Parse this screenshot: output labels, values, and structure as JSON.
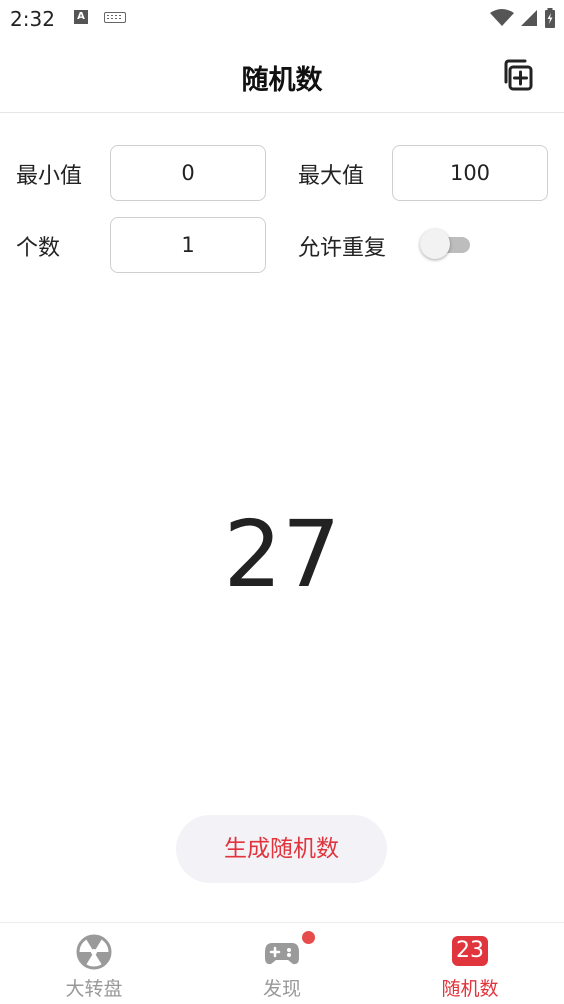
{
  "status_bar": {
    "time": "2:32",
    "notification_icon": "A"
  },
  "header": {
    "title": "随机数",
    "copy_icon": "copy-add-icon"
  },
  "form": {
    "min_label": "最小值",
    "min_value": "0",
    "max_label": "最大值",
    "max_value": "100",
    "count_label": "个数",
    "count_value": "1",
    "repeat_label": "允许重复",
    "allow_repeat": false
  },
  "result": {
    "value": "27"
  },
  "generate_button": {
    "label": "生成随机数"
  },
  "bottom_nav": {
    "items": [
      {
        "label": "大转盘",
        "icon": "wheel-icon",
        "active": false
      },
      {
        "label": "发现",
        "icon": "gamepad-icon",
        "active": false,
        "has_dot": true
      },
      {
        "label": "随机数",
        "icon": "number-icon",
        "icon_text": "23",
        "active": true
      }
    ]
  },
  "colors": {
    "accent": "#e0353d",
    "inactive": "#999999",
    "button_bg": "#f3f2f7"
  }
}
